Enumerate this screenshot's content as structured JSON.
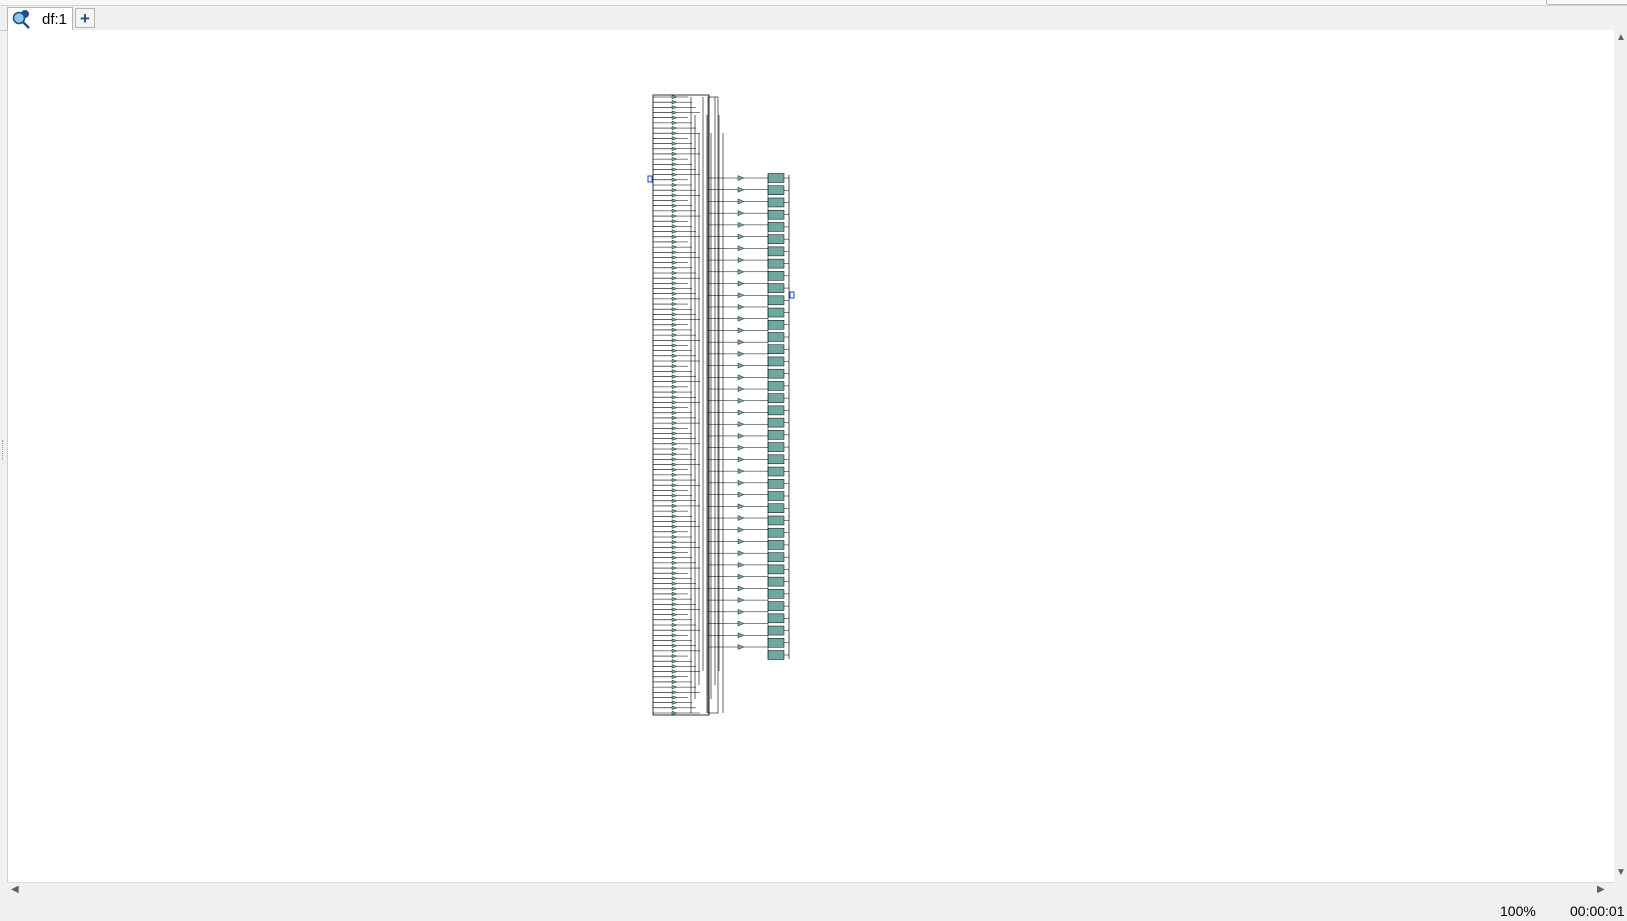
{
  "tabs": [
    {
      "label": "df:1",
      "icon": "schematic-search-icon"
    }
  ],
  "add_tab_label": "+",
  "status": {
    "zoom": "100%",
    "timer": "00:00:01"
  },
  "schematic": {
    "left_inputs": 120,
    "mid_gates": 41,
    "output_blocks": 40,
    "accent_color": "#6fa8a0",
    "port_color": "#1a3ccc",
    "wire_color": "#000000"
  }
}
